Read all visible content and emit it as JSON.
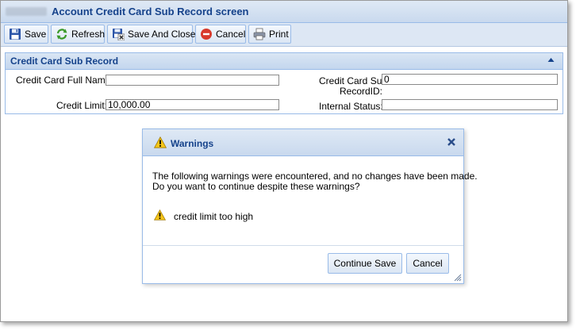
{
  "window": {
    "title": "Account Credit Card Sub Record screen"
  },
  "toolbar": {
    "save": "Save",
    "refresh": "Refresh",
    "save_and_close": "Save And Close",
    "cancel": "Cancel",
    "print": "Print"
  },
  "panel": {
    "title": "Credit Card Sub Record",
    "fields": {
      "full_name_label": "Credit Card Full Name:",
      "full_name_value": "",
      "credit_limit_label": "Credit Limit:",
      "credit_limit_value": "10,000.00",
      "sub_record_id_label_line1": "Credit Card Sub",
      "sub_record_id_label_line2": "RecordID:",
      "sub_record_id_value": "0",
      "internal_status_label": "Internal Status:",
      "internal_status_value": ""
    }
  },
  "dialog": {
    "title": "Warnings",
    "message_line1": "The following warnings were encountered, and no changes have been made.",
    "message_line2": "Do you want to continue despite these warnings?",
    "warnings": [
      "credit limit too high"
    ],
    "continue_button": "Continue Save",
    "cancel_button": "Cancel"
  },
  "colors": {
    "title_text": "#15428b",
    "border_accent": "#99bbe8",
    "header_bg": "#c9d9ee"
  },
  "icons": {
    "save": "floppy-disk-icon",
    "refresh": "refresh-arrows-icon",
    "save_and_close": "save-close-icon",
    "cancel": "red-cancel-icon",
    "print": "printer-icon",
    "warning": "warning-triangle-icon",
    "close": "close-x-icon"
  }
}
